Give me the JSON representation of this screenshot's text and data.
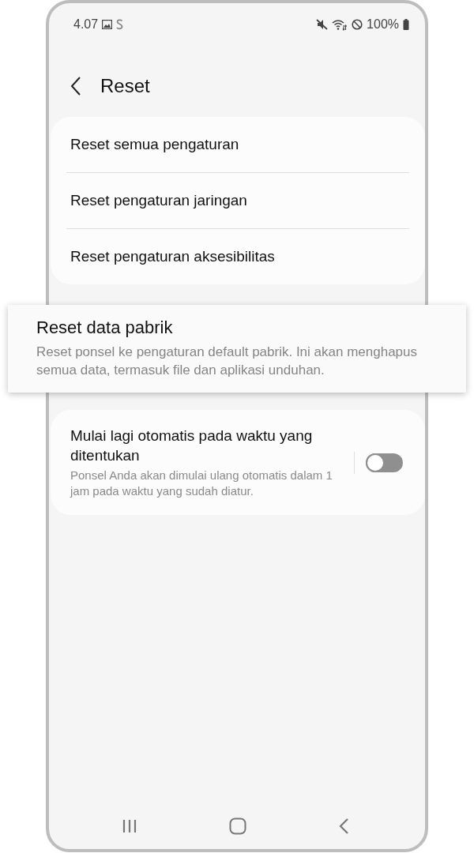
{
  "status_bar": {
    "time": "4.07",
    "battery": "100%"
  },
  "header": {
    "title": "Reset"
  },
  "reset_options": [
    {
      "label": "Reset semua pengaturan"
    },
    {
      "label": "Reset pengaturan jaringan"
    },
    {
      "label": "Reset pengaturan aksesibilitas"
    }
  ],
  "factory_reset": {
    "title": "Reset data pabrik",
    "description": "Reset ponsel ke pengaturan default pabrik. Ini akan menghapus semua data, termasuk file dan aplikasi unduhan."
  },
  "auto_restart": {
    "title": "Mulai lagi otomatis pada waktu yang ditentukan",
    "description": "Ponsel Anda akan dimulai ulang otomatis dalam 1 jam pada waktu yang sudah diatur.",
    "on": false
  }
}
